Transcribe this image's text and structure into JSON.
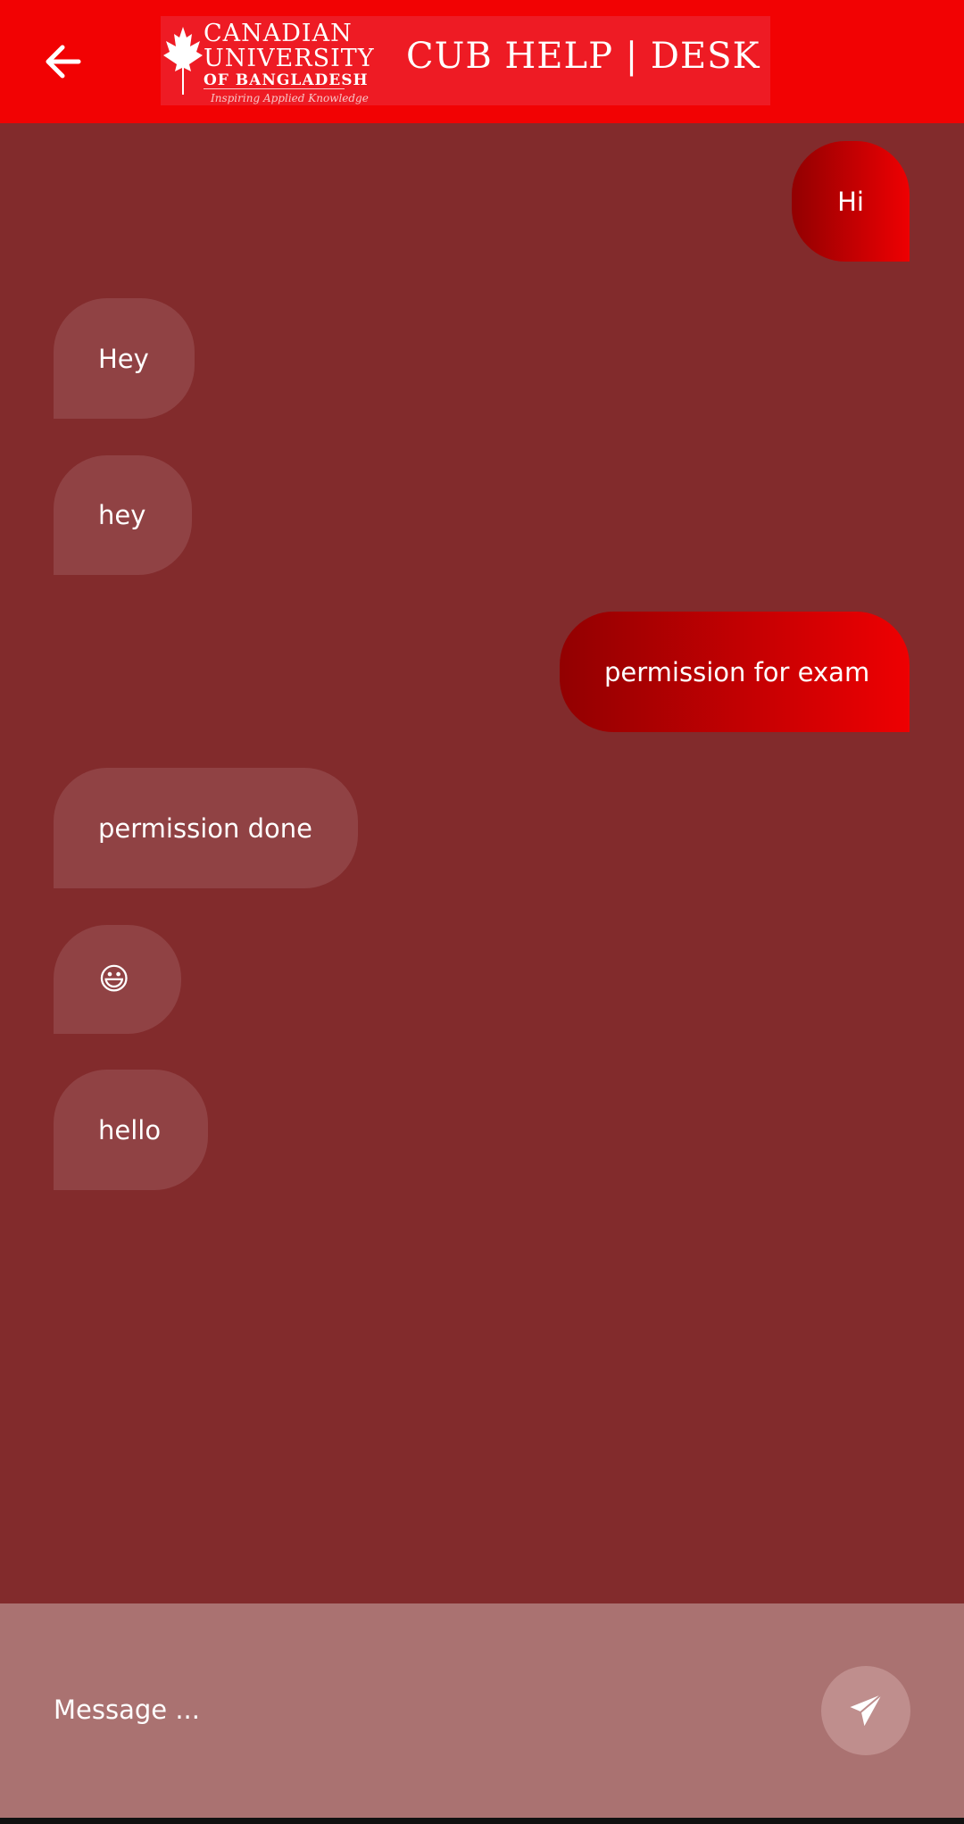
{
  "header": {
    "back_icon": "arrow-left-icon",
    "logo": {
      "line1": "CANADIAN",
      "line2": "UNIVERSITY",
      "line3": "OF BANGLADESH",
      "tagline": "Inspiring Applied Knowledge"
    },
    "title": "CUB HELP | DESK",
    "colors": {
      "appbar": "#f20203",
      "banner": "#ee1b24"
    }
  },
  "chat": {
    "background": "#822b2c",
    "messages": [
      {
        "direction": "sent",
        "text": "Hi"
      },
      {
        "direction": "received",
        "text": "Hey"
      },
      {
        "direction": "received",
        "text": "hey"
      },
      {
        "direction": "sent",
        "text": "permission for exam"
      },
      {
        "direction": "received",
        "text": "permission done"
      },
      {
        "direction": "received",
        "text": "😃"
      },
      {
        "direction": "received",
        "text": "hello"
      }
    ]
  },
  "composer": {
    "placeholder": "Message ...",
    "value": "",
    "send_icon": "paper-plane-icon"
  }
}
